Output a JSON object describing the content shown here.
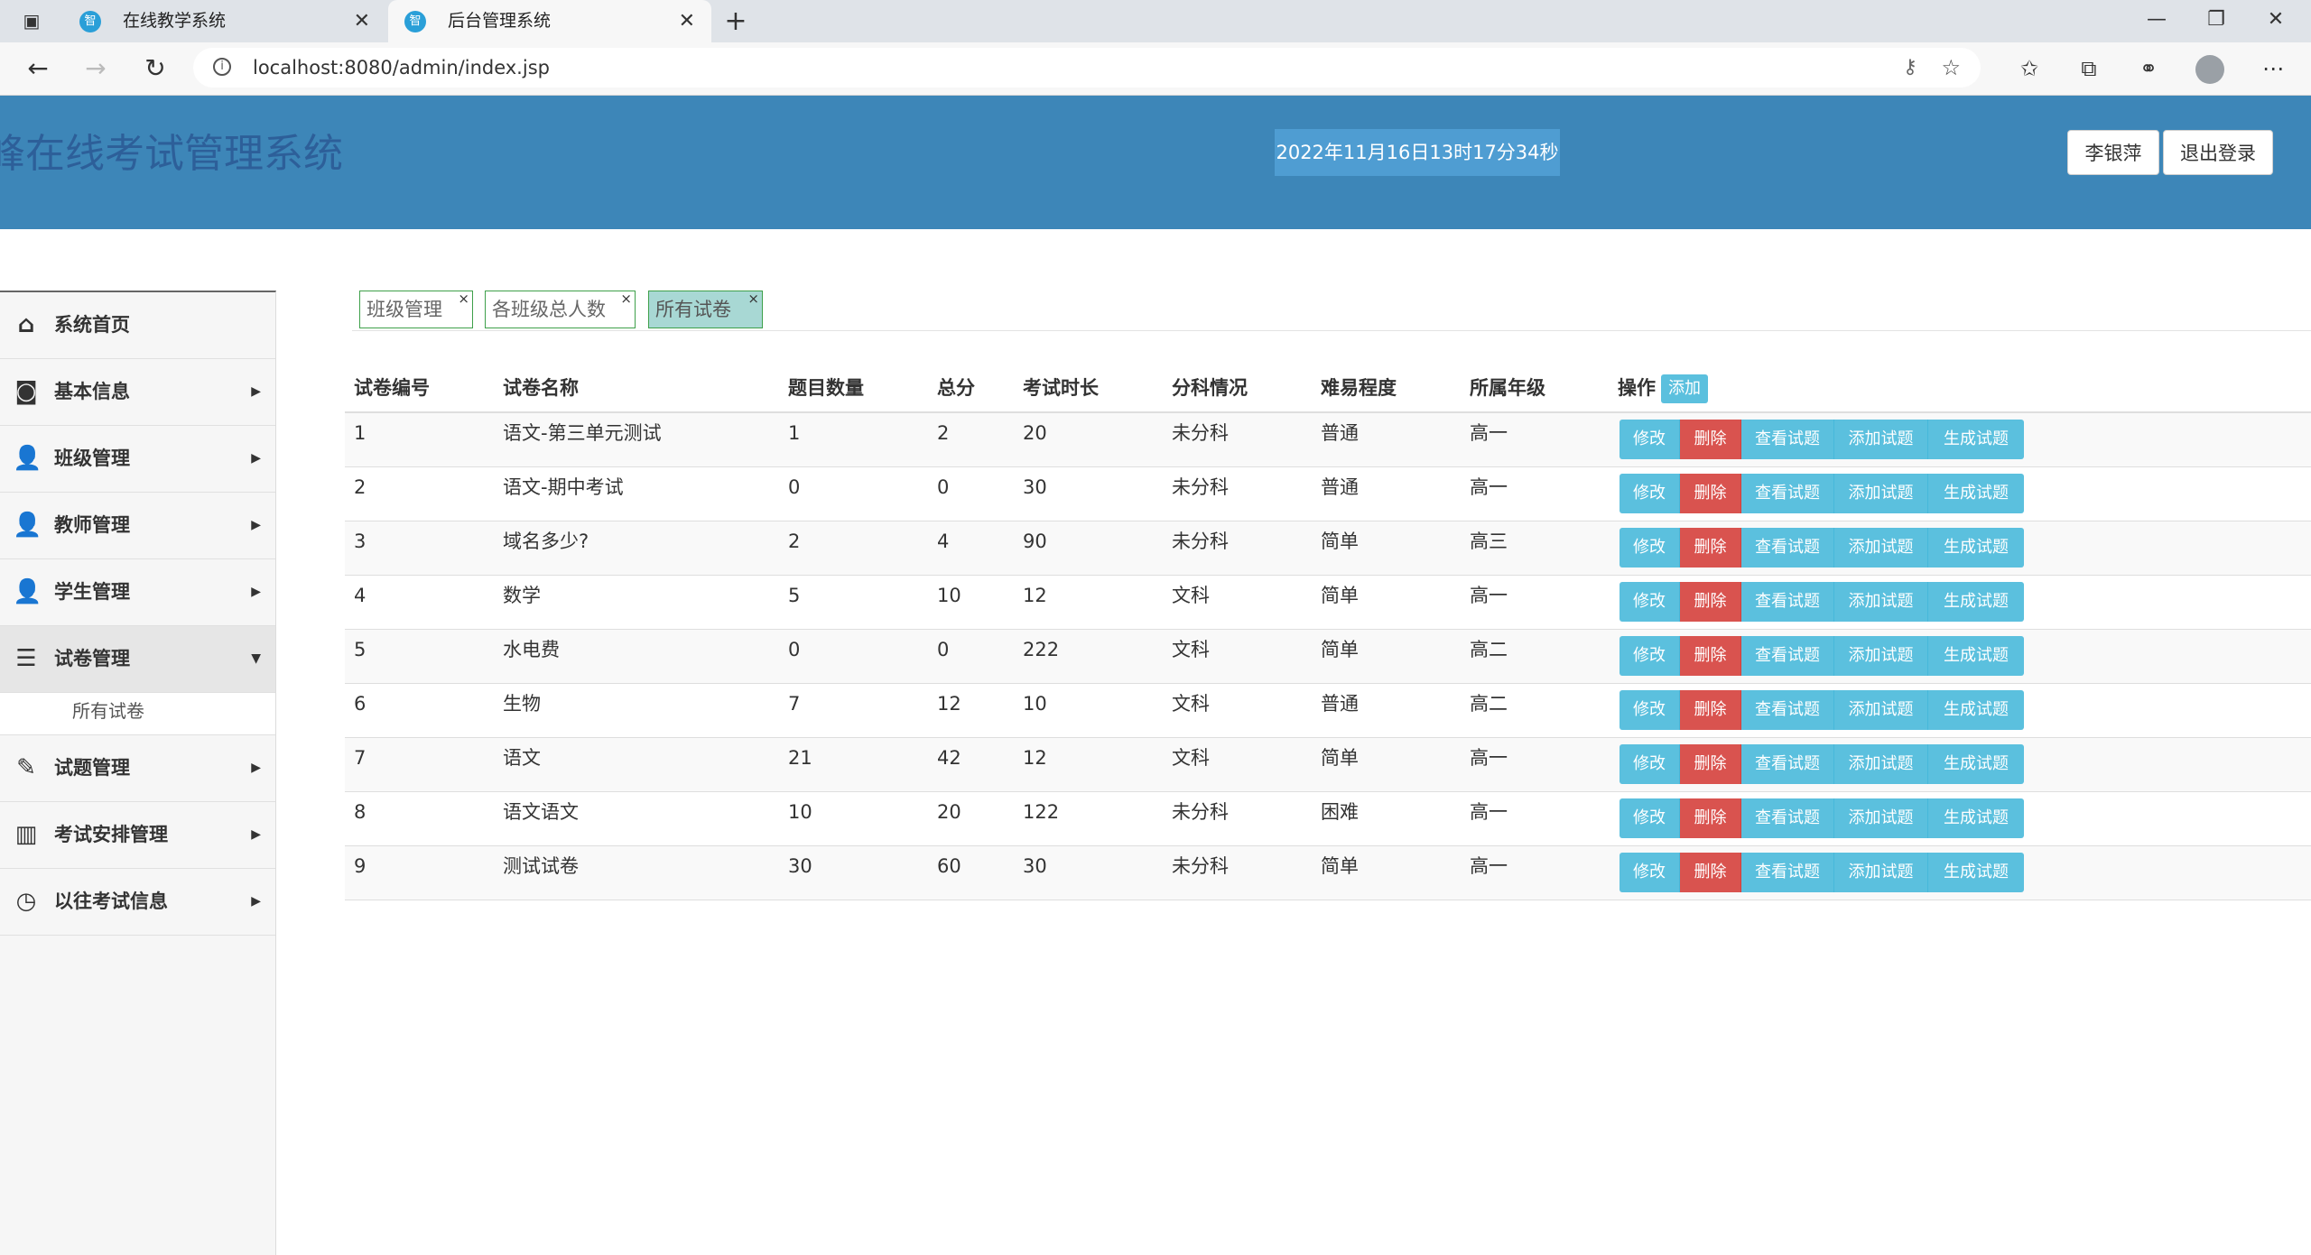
{
  "browser": {
    "tabs": [
      {
        "title": "在线教学系统",
        "favicon": "智"
      },
      {
        "title": "后台管理系统",
        "favicon": "智"
      }
    ],
    "url": "localhost:8080/admin/index.jsp"
  },
  "header": {
    "title": "峰在线考试管理系统",
    "datetime": "2022年11月16日13时17分34秒",
    "user_button": "李银萍",
    "logout_button": "退出登录",
    "background_color": "#3d86b8"
  },
  "sidebar": {
    "items": [
      {
        "label": "系统首页",
        "icon": "home-icon"
      },
      {
        "label": "基本信息",
        "icon": "monitor-icon"
      },
      {
        "label": "班级管理",
        "icon": "class-icon"
      },
      {
        "label": "教师管理",
        "icon": "teacher-icon"
      },
      {
        "label": "学生管理",
        "icon": "student-icon"
      },
      {
        "label": "试卷管理",
        "icon": "paper-icon"
      },
      {
        "label": "试题管理",
        "icon": "question-icon"
      },
      {
        "label": "考试安排管理",
        "icon": "books-icon"
      },
      {
        "label": "以往考试信息",
        "icon": "clock-icon"
      }
    ],
    "submenu": [
      "所有试卷"
    ]
  },
  "breadcrumb_tabs": [
    "班级管理",
    "各班级总人数",
    "所有试卷"
  ],
  "table": {
    "columns": [
      "试卷编号",
      "试卷名称",
      "题目数量",
      "总分",
      "考试时长",
      "分科情况",
      "难易程度",
      "所属年级",
      "操作"
    ],
    "add_label": "添加",
    "actions": [
      "修改",
      "删除",
      "查看试题",
      "添加试题",
      "生成试题"
    ],
    "rows": [
      [
        "1",
        "语文-第三单元测试",
        "1",
        "2",
        "20",
        "未分科",
        "普通",
        "高一"
      ],
      [
        "2",
        "语文-期中考试",
        "0",
        "0",
        "30",
        "未分科",
        "普通",
        "高一"
      ],
      [
        "3",
        "域名多少?",
        "2",
        "4",
        "90",
        "未分科",
        "简单",
        "高三"
      ],
      [
        "4",
        "数学",
        "5",
        "10",
        "12",
        "文科",
        "简单",
        "高一"
      ],
      [
        "5",
        "水电费",
        "0",
        "0",
        "222",
        "文科",
        "简单",
        "高二"
      ],
      [
        "6",
        "生物",
        "7",
        "12",
        "10",
        "文科",
        "普通",
        "高二"
      ],
      [
        "7",
        "语文",
        "21",
        "42",
        "12",
        "文科",
        "简单",
        "高一"
      ],
      [
        "8",
        "语文语文",
        "10",
        "20",
        "122",
        "未分科",
        "困难",
        "高一"
      ],
      [
        "9",
        "测试试卷",
        "30",
        "60",
        "30",
        "未分科",
        "简单",
        "高一"
      ]
    ]
  }
}
